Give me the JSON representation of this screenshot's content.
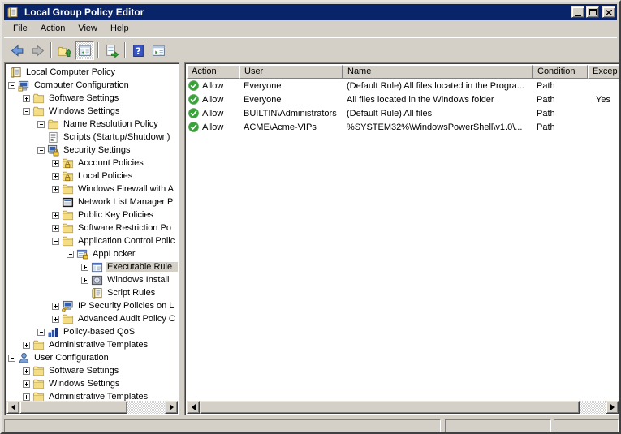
{
  "titlebar": {
    "title": "Local Group Policy Editor",
    "app_icon": "scroll-icon",
    "buttons": [
      "minimize",
      "maximize",
      "close"
    ]
  },
  "menubar": {
    "items": [
      "File",
      "Action",
      "View",
      "Help"
    ]
  },
  "toolbar": {
    "buttons": [
      {
        "type": "button",
        "name": "back",
        "icon": "back-icon",
        "pressed": false
      },
      {
        "type": "button",
        "name": "forward",
        "icon": "forward-icon",
        "pressed": false
      },
      {
        "type": "separator"
      },
      {
        "type": "button",
        "name": "up-one-level",
        "icon": "up-folder-icon",
        "pressed": false
      },
      {
        "type": "button",
        "name": "show-console-tree",
        "icon": "console-tree-icon",
        "pressed": true
      },
      {
        "type": "separator"
      },
      {
        "type": "button",
        "name": "export-list",
        "icon": "export-list-icon",
        "pressed": false
      },
      {
        "type": "separator"
      },
      {
        "type": "button",
        "name": "help",
        "icon": "help-icon",
        "pressed": false
      },
      {
        "type": "button",
        "name": "show-window",
        "icon": "new-window-icon",
        "pressed": false
      }
    ]
  },
  "tree": {
    "items": [
      {
        "label": "Local Computer Policy",
        "level": 0,
        "icon": "scroll-icon",
        "expander": null,
        "selected": false
      },
      {
        "label": "Computer Configuration",
        "level": 1,
        "icon": "computer-icon",
        "expander": "expanded",
        "selected": false
      },
      {
        "label": "Software Settings",
        "level": 2,
        "icon": "folder-icon",
        "expander": "collapsed",
        "selected": false
      },
      {
        "label": "Windows Settings",
        "level": 2,
        "icon": "folder-icon",
        "expander": "expanded",
        "selected": false
      },
      {
        "label": "Name Resolution Policy",
        "level": 3,
        "icon": "folder-icon",
        "expander": "collapsed",
        "selected": false
      },
      {
        "label": "Scripts (Startup/Shutdown)",
        "level": 3,
        "icon": "script-icon",
        "expander": null,
        "selected": false
      },
      {
        "label": "Security Settings",
        "level": 3,
        "icon": "security-icon",
        "expander": "expanded",
        "selected": false
      },
      {
        "label": "Account Policies",
        "level": 4,
        "icon": "folder-lock-icon",
        "expander": "collapsed",
        "selected": false
      },
      {
        "label": "Local Policies",
        "level": 4,
        "icon": "folder-lock-icon",
        "expander": "collapsed",
        "selected": false
      },
      {
        "label": "Windows Firewall with A",
        "level": 4,
        "icon": "folder-icon",
        "expander": "collapsed",
        "selected": false
      },
      {
        "label": "Network List Manager P",
        "level": 4,
        "icon": "netlist-icon",
        "expander": null,
        "selected": false
      },
      {
        "label": "Public Key Policies",
        "level": 4,
        "icon": "folder-icon",
        "expander": "collapsed",
        "selected": false
      },
      {
        "label": "Software Restriction Po",
        "level": 4,
        "icon": "folder-icon",
        "expander": "collapsed",
        "selected": false
      },
      {
        "label": "Application Control Polic",
        "level": 4,
        "icon": "folder-icon",
        "expander": "expanded",
        "selected": false
      },
      {
        "label": "AppLocker",
        "level": 5,
        "icon": "applocker-icon",
        "expander": "expanded",
        "selected": false
      },
      {
        "label": "Executable Rule",
        "level": 6,
        "icon": "exe-rules-icon",
        "expander": "collapsed",
        "selected": true
      },
      {
        "label": "Windows Install",
        "level": 6,
        "icon": "installer-icon",
        "expander": "collapsed",
        "selected": false
      },
      {
        "label": "Script Rules",
        "level": 6,
        "icon": "scroll-icon",
        "expander": null,
        "selected": false
      },
      {
        "label": "IP Security Policies on L",
        "level": 4,
        "icon": "ipsec-icon",
        "expander": "collapsed",
        "selected": false
      },
      {
        "label": "Advanced Audit Policy C",
        "level": 4,
        "icon": "folder-icon",
        "expander": "collapsed",
        "selected": false
      },
      {
        "label": "Policy-based QoS",
        "level": 3,
        "icon": "qos-icon",
        "expander": "collapsed",
        "selected": false
      },
      {
        "label": "Administrative Templates",
        "level": 2,
        "icon": "folder-icon",
        "expander": "collapsed",
        "selected": false
      },
      {
        "label": "User Configuration",
        "level": 1,
        "icon": "user-icon",
        "expander": "expanded",
        "selected": false
      },
      {
        "label": "Software Settings",
        "level": 2,
        "icon": "folder-icon",
        "expander": "collapsed",
        "selected": false
      },
      {
        "label": "Windows Settings",
        "level": 2,
        "icon": "folder-icon",
        "expander": "collapsed",
        "selected": false
      },
      {
        "label": "Administrative Templates",
        "level": 2,
        "icon": "folder-icon",
        "expander": "collapsed",
        "selected": false
      }
    ]
  },
  "list": {
    "columns": [
      "Action",
      "User",
      "Name",
      "Condition",
      "Excep"
    ],
    "rows": [
      {
        "status_icon": "allow-icon",
        "action": "Allow",
        "user": "Everyone",
        "name": "(Default Rule) All files located in the Progra...",
        "condition": "Path",
        "exception": ""
      },
      {
        "status_icon": "allow-icon",
        "action": "Allow",
        "user": "Everyone",
        "name": "All files located in the Windows folder",
        "condition": "Path",
        "exception": "Yes"
      },
      {
        "status_icon": "allow-icon",
        "action": "Allow",
        "user": "BUILTIN\\Administrators",
        "name": "(Default Rule) All files",
        "condition": "Path",
        "exception": ""
      },
      {
        "status_icon": "allow-icon",
        "action": "Allow",
        "user": "ACME\\Acme-VIPs",
        "name": "%SYSTEM32%\\WindowsPowerShell\\v1.0\\...",
        "condition": "Path",
        "exception": ""
      }
    ]
  },
  "statusbar": {
    "panels": [
      "",
      "",
      ""
    ]
  },
  "colors": {
    "titlebar_blue": "#0a246a",
    "chrome_gray": "#d4d0c8",
    "allow_green": "#2e9e2e",
    "selection_inactive": "#d4d0c8"
  }
}
